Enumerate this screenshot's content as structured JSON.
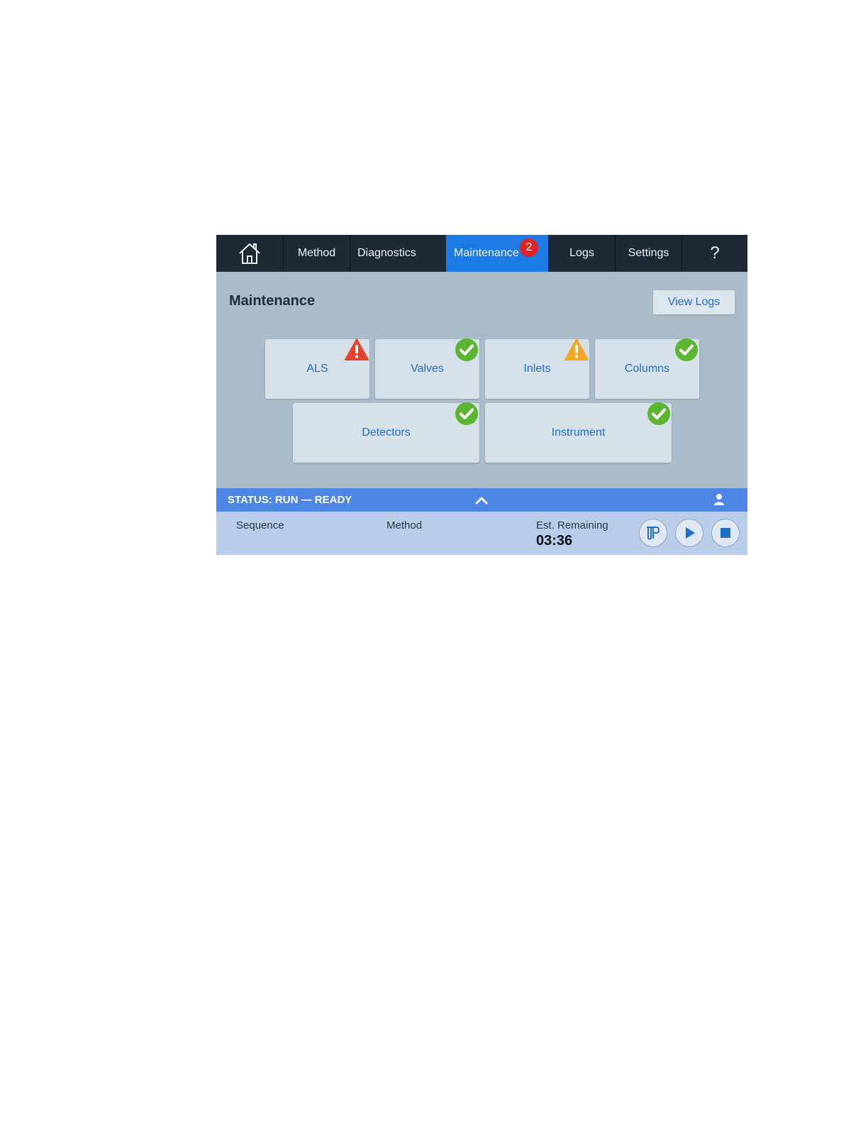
{
  "nav": {
    "home_icon": "home-icon",
    "tabs": [
      {
        "label": "Method"
      },
      {
        "label": "Diagnostics"
      },
      {
        "label": "Maintenance",
        "badge": "2",
        "active": true
      },
      {
        "label": "Logs"
      },
      {
        "label": "Settings"
      }
    ],
    "help_label": "?"
  },
  "header": {
    "title": "Maintenance",
    "view_logs_label": "View Logs"
  },
  "tiles": [
    {
      "label": "ALS",
      "status": "error"
    },
    {
      "label": "Valves",
      "status": "ok"
    },
    {
      "label": "Inlets",
      "status": "warning"
    },
    {
      "label": "Columns",
      "status": "ok"
    },
    {
      "label": "Detectors",
      "status": "ok"
    },
    {
      "label": "Instrument",
      "status": "ok"
    }
  ],
  "status_bar": {
    "text": "STATUS: RUN — READY"
  },
  "bottom": {
    "sequence_label": "Sequence",
    "method_label": "Method",
    "remaining_label": "Est. Remaining",
    "remaining_value": "03:36"
  },
  "colors": {
    "nav_bg": "#1d2a35",
    "active_tab": "#1e7be6",
    "badge": "#e32222",
    "ok": "#5cb531",
    "warning": "#f5a623",
    "error": "#e8402e",
    "status_bar": "#4d86e4",
    "link_text": "#1e6fc8"
  }
}
